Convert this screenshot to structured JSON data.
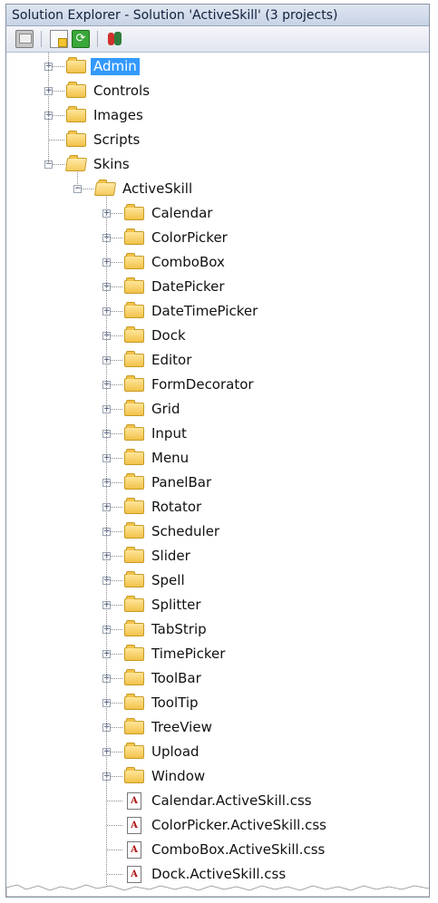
{
  "window": {
    "title": "Solution Explorer - Solution 'ActiveSkill' (3 projects)"
  },
  "toolbar": {
    "buttons": [
      {
        "name": "properties-button",
        "icon": "properties-icon"
      },
      {
        "name": "show-all-files-button",
        "icon": "show-all-files-icon"
      },
      {
        "name": "refresh-button",
        "icon": "refresh-icon",
        "glyph": "⟳"
      },
      {
        "name": "view-class-diagram-button",
        "icon": "class-diagram-icon"
      }
    ]
  },
  "tree": {
    "top_level": [
      {
        "label": "Admin",
        "expander": "+",
        "selected": true
      },
      {
        "label": "Controls",
        "expander": "+"
      },
      {
        "label": "Images",
        "expander": "+"
      },
      {
        "label": "Scripts",
        "expander": ""
      },
      {
        "label": "Skins",
        "expander": "−",
        "open": true
      }
    ],
    "skins_child": {
      "label": "ActiveSkill",
      "expander": "−",
      "open": true
    },
    "activeskill_folders": [
      "Calendar",
      "ColorPicker",
      "ComboBox",
      "DatePicker",
      "DateTimePicker",
      "Dock",
      "Editor",
      "FormDecorator",
      "Grid",
      "Input",
      "Menu",
      "PanelBar",
      "Rotator",
      "Scheduler",
      "Slider",
      "Spell",
      "Splitter",
      "TabStrip",
      "TimePicker",
      "ToolBar",
      "ToolTip",
      "TreeView",
      "Upload",
      "Window"
    ],
    "activeskill_files": [
      "Calendar.ActiveSkill.css",
      "ColorPicker.ActiveSkill.css",
      "ComboBox.ActiveSkill.css",
      "Dock.ActiveSkill.css"
    ],
    "file_icon_text": "A"
  },
  "colors": {
    "selection": "#3399ff",
    "folder": "#f2c24a",
    "title_bar": "#c7d3e6"
  }
}
